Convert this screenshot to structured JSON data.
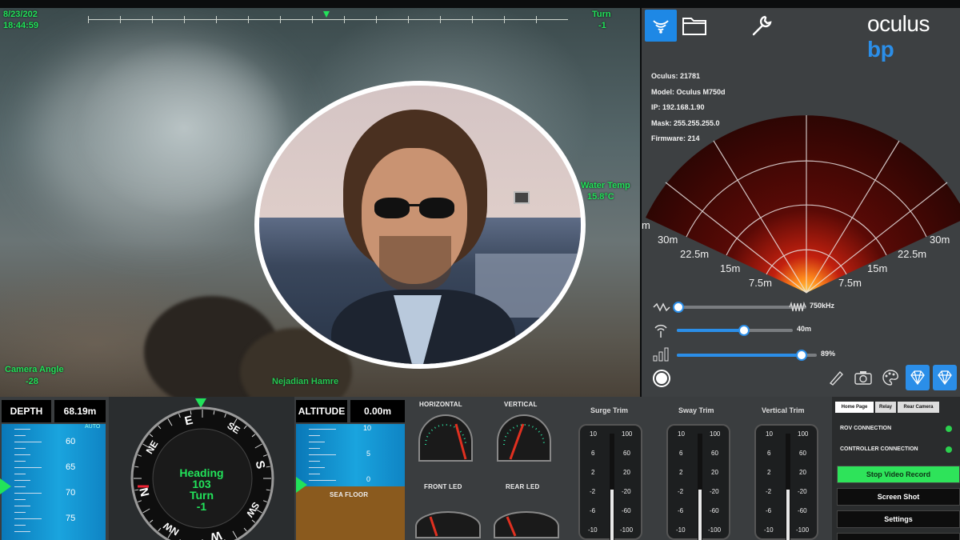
{
  "camera": {
    "date": "8/23/202",
    "time": "18:44:59",
    "turn_label": "Turn",
    "turn_value": "-1",
    "water_temp_label": "Water Temp",
    "water_temp_value": "15.8°C",
    "camera_angle_label": "Camera Angle",
    "camera_angle_value": "-28",
    "bottom_text": "Nejadian Hamre"
  },
  "sonar": {
    "logo_text": "oculus",
    "logo_brand": "bp",
    "info": [
      "Oculus: 21781",
      "Model: Oculus M750d",
      "IP: 192.168.1.90",
      "Mask: 255.255.255.0",
      "Firmware: 214"
    ],
    "range_labels": {
      "left_30": "30m",
      "left_22": "22.5m",
      "left_15": "15m",
      "left_7": "7.5m",
      "right_7": "7.5m",
      "right_15": "15m",
      "right_22": "22.5m",
      "right_30": "30m",
      "edge": "m"
    },
    "sliders": [
      {
        "name": "frequency",
        "value_text": "750kHz",
        "level": 0.0
      },
      {
        "name": "range",
        "value_text": "40m",
        "level": 0.58
      },
      {
        "name": "gain",
        "value_text": "89%",
        "level": 0.89
      }
    ],
    "colors": {
      "accent": "#2b8ee8"
    }
  },
  "depth": {
    "label": "DEPTH",
    "value": "68.19m",
    "auto": "AUTO",
    "ticks": [
      "60",
      "65",
      "70",
      "75"
    ]
  },
  "compass": {
    "heading_label": "Heading",
    "heading_value": "103",
    "turn_label": "Turn",
    "turn_value": "-1",
    "cardinals": [
      "N",
      "NE",
      "E",
      "SE",
      "S",
      "SW",
      "W",
      "NW"
    ]
  },
  "altitude": {
    "label": "ALTITUDE",
    "value": "0.00m",
    "ticks": [
      "10",
      "5",
      "0"
    ],
    "seafloor": "SEA FLOOR"
  },
  "lights": {
    "horizontal": "HORIZONTAL",
    "vertical": "VERTICAL",
    "front_led": "FRONT LED",
    "rear_led": "REAR LED"
  },
  "trims": [
    {
      "title": "Surge Trim",
      "left": [
        "10",
        "6",
        "2",
        "-2",
        "-6",
        "-10"
      ],
      "right": [
        "100",
        "60",
        "20",
        "-20",
        "-60",
        "-100"
      ]
    },
    {
      "title": "Sway Trim",
      "left": [
        "10",
        "6",
        "2",
        "-2",
        "-6",
        "-10"
      ],
      "right": [
        "100",
        "60",
        "20",
        "-20",
        "-60",
        "-100"
      ]
    },
    {
      "title": "Vertical Trim",
      "left": [
        "10",
        "6",
        "2",
        "-2",
        "-6",
        "-10"
      ],
      "right": [
        "100",
        "60",
        "20",
        "-20",
        "-60",
        "-100"
      ]
    }
  ],
  "controls": {
    "tabs": [
      "Home Page",
      "Relay",
      "Rear Camera"
    ],
    "rov_connection": "ROV CONNECTION",
    "controller_connection": "CONTROLLER CONNECTION",
    "buttons": [
      "Stop Video Record",
      "Screen Shot",
      "Settings"
    ]
  }
}
